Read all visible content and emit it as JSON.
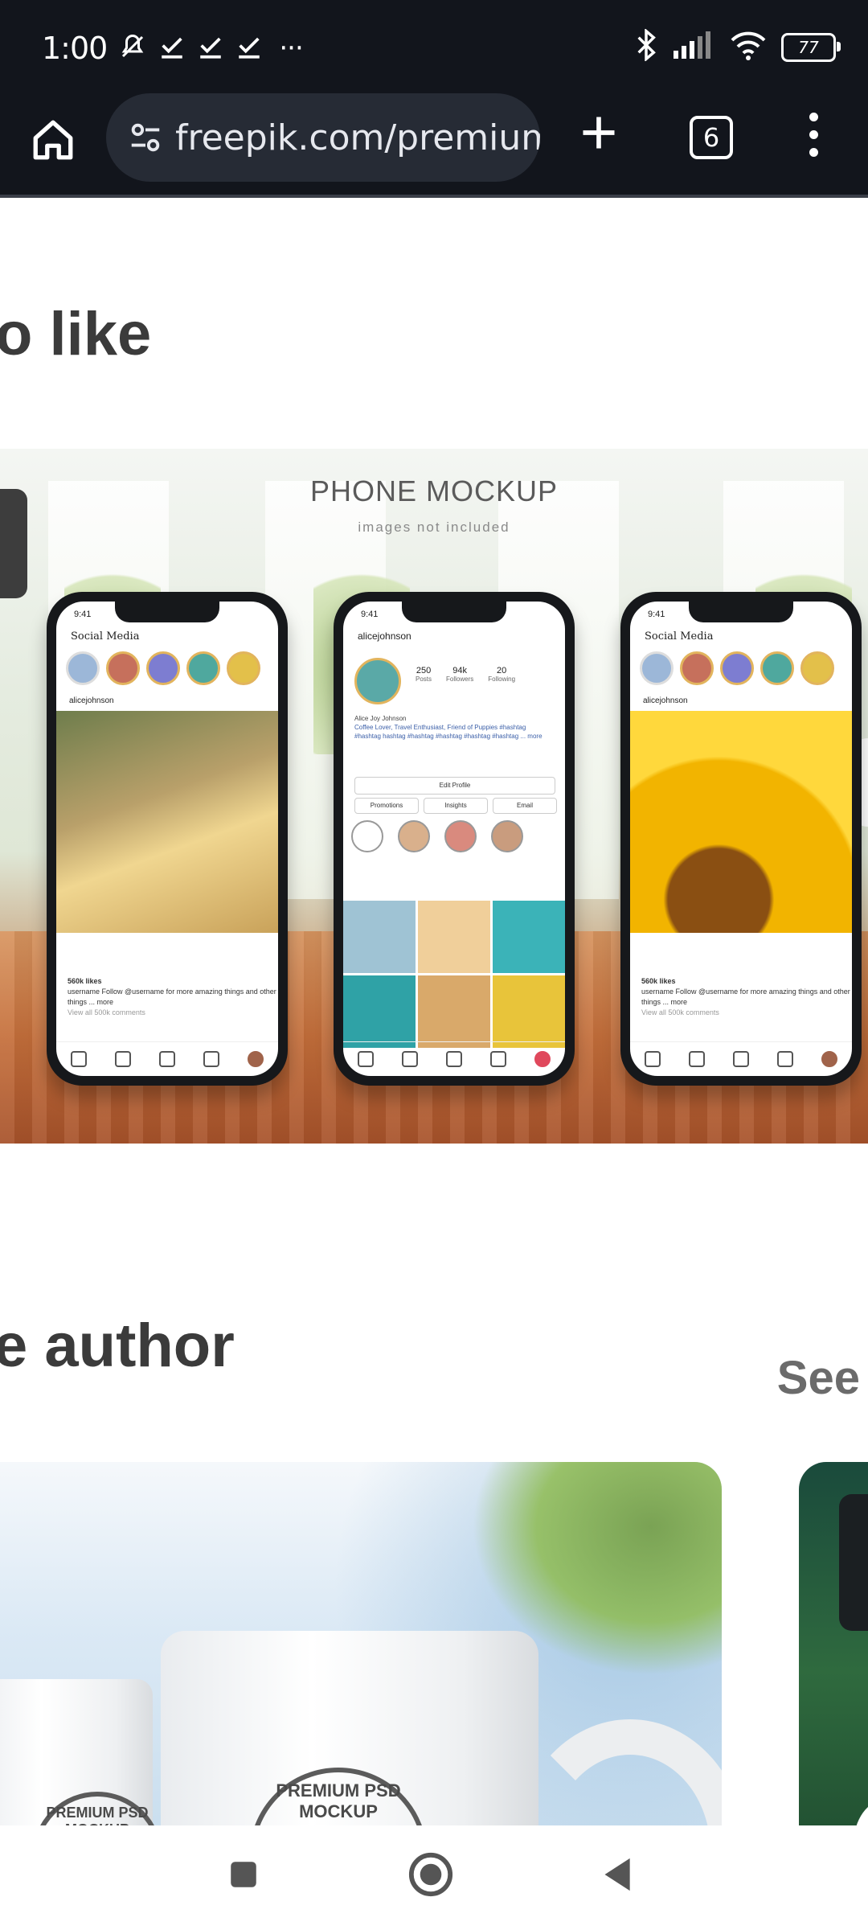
{
  "status_bar": {
    "time": "1:00",
    "more": "···",
    "battery": "77",
    "icons": [
      "notifications-off-icon",
      "check-icon",
      "check-icon",
      "check-icon",
      "bluetooth-icon",
      "signal-icon",
      "wifi-icon",
      "battery-icon"
    ]
  },
  "browser": {
    "url": "freepik.com/premium-",
    "tab_count": "6",
    "icons": [
      "home-icon",
      "site-settings-icon",
      "new-tab-plus-icon",
      "tab-switcher-icon",
      "more-vert-icon"
    ]
  },
  "sections": {
    "related_heading": "o like",
    "author_heading": "e author",
    "see_link": "See"
  },
  "hero_image": {
    "title": "PHONE MOCKUP",
    "subtitle": "images not included",
    "phone1": {
      "time": "9:41",
      "header": "Social Media",
      "user": "alicejohnson",
      "likes": "560k likes",
      "caption": "username Follow @username for more amazing things and other things ... more",
      "comments": "View all 500k comments"
    },
    "phone2": {
      "time": "9:41",
      "user": "alicejohnson",
      "posts": "250",
      "posts_label": "Posts",
      "followers": "94k",
      "followers_label": "Followers",
      "following": "20",
      "following_label": "Following",
      "name": "Alice Joy Johnson",
      "bio": "Coffee Lover, Travel Enthusiast, Friend of Puppies #hashtag #hashtag hashtag #hashtag #hashtag #hashtag #hashtag ... more",
      "edit_profile": "Edit Profile",
      "btn_promotions": "Promotions",
      "btn_insights": "Insights",
      "btn_email": "Email"
    },
    "phone3": {
      "time": "9:41",
      "header": "Social Media",
      "user": "alicejohnson",
      "likes": "560k likes",
      "caption": "username Follow @username for more amazing things and other things ... more",
      "comments": "View all 500k comments"
    }
  },
  "author_card": {
    "mug_logo_text": "PREMIUM PSD MOCKUP"
  },
  "nav_bar": {
    "icons": [
      "recents-square-icon",
      "home-circle-icon",
      "back-triangle-icon"
    ]
  },
  "colors": {
    "chrome_bg": "#12151c",
    "url_pill_bg": "#262b35",
    "heading_text": "#3b3b3b",
    "see_link": "#6b6b6b"
  }
}
